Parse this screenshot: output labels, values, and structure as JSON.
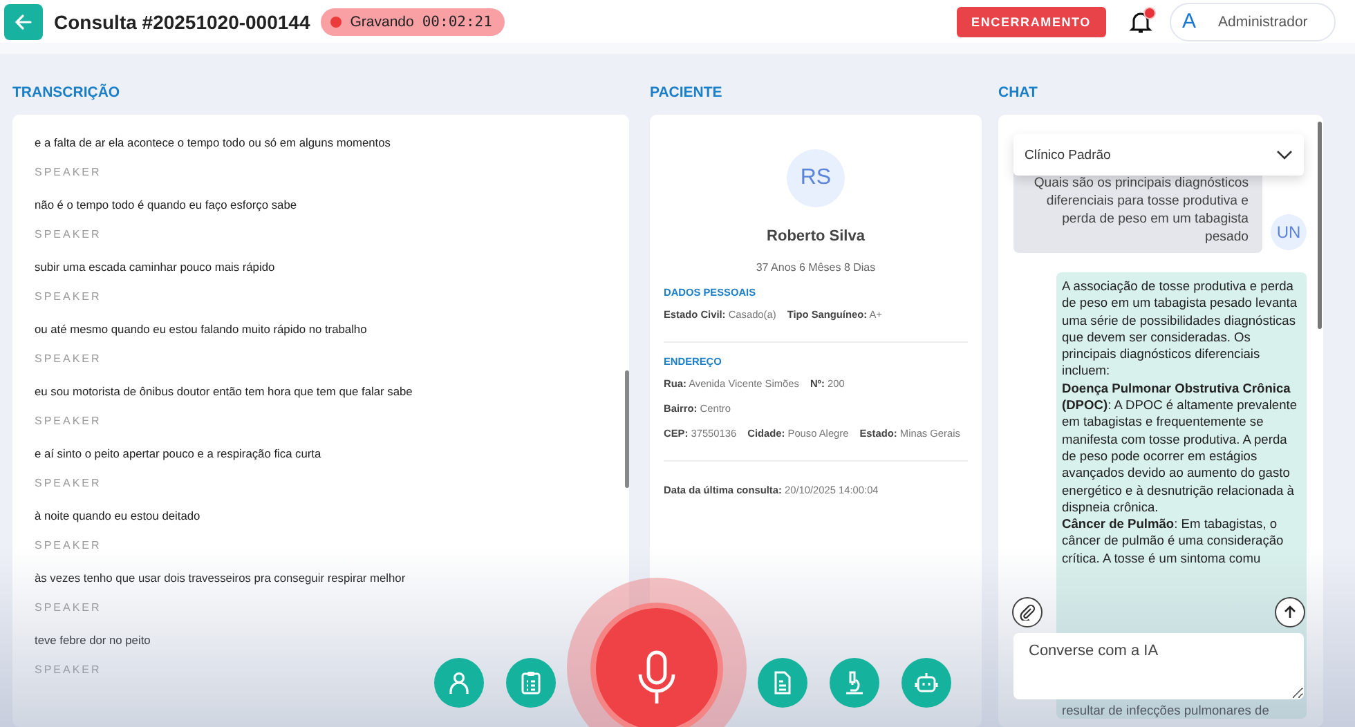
{
  "header": {
    "title": "Consulta #20251020-000144",
    "recording": {
      "label": "Gravando",
      "time": "00:02:21",
      "on": true
    },
    "end_button": "ENCERRAMENTO",
    "notifications": {
      "unread": true
    },
    "user": {
      "initial": "A",
      "name": "Administrador"
    }
  },
  "transcription": {
    "title": "TRANSCRIÇÃO",
    "lines": [
      {
        "kind": "text",
        "text": "e a falta de ar ela acontece o tempo todo ou só em alguns momentos"
      },
      {
        "kind": "speaker",
        "text": "SPEAKER"
      },
      {
        "kind": "text",
        "text": "não é o tempo todo é quando eu faço esforço sabe"
      },
      {
        "kind": "speaker",
        "text": "SPEAKER"
      },
      {
        "kind": "text",
        "text": "subir uma escada caminhar pouco mais rápido"
      },
      {
        "kind": "speaker",
        "text": "SPEAKER"
      },
      {
        "kind": "text",
        "text": "ou até mesmo quando eu estou falando muito rápido no trabalho"
      },
      {
        "kind": "speaker",
        "text": "SPEAKER"
      },
      {
        "kind": "text",
        "text": "eu sou motorista de ônibus doutor então tem hora que tem que falar sabe"
      },
      {
        "kind": "speaker",
        "text": "SPEAKER"
      },
      {
        "kind": "text",
        "text": "e aí sinto o peito apertar pouco e a respiração fica curta"
      },
      {
        "kind": "speaker",
        "text": "SPEAKER"
      },
      {
        "kind": "text",
        "text": "à noite quando eu estou deitado"
      },
      {
        "kind": "speaker",
        "text": "SPEAKER"
      },
      {
        "kind": "text",
        "text": "às vezes tenho que usar dois travesseiros pra conseguir respirar melhor"
      },
      {
        "kind": "speaker",
        "text": "SPEAKER"
      },
      {
        "kind": "text",
        "text": "teve febre dor no peito"
      },
      {
        "kind": "speaker",
        "text": "SPEAKER"
      }
    ]
  },
  "patient": {
    "title": "PACIENTE",
    "initials": "RS",
    "name": "Roberto Silva",
    "age": "37 Anos 6 Mêses 8 Dias",
    "sections": [
      {
        "title": "DADOS PESSOAIS",
        "rows": [
          [
            {
              "label": "Estado Civil:",
              "value": "Casado(a)"
            },
            {
              "label": "Tipo Sanguíneo:",
              "value": "A+"
            }
          ]
        ]
      },
      {
        "title": "ENDEREÇO",
        "rows": [
          [
            {
              "label": "Rua:",
              "value": "Avenida Vicente Simões"
            },
            {
              "label": "Nº:",
              "value": "200"
            }
          ],
          [
            {
              "label": "Bairro:",
              "value": "Centro"
            }
          ],
          [
            {
              "label": "CEP:",
              "value": "37550136"
            },
            {
              "label": "Cidade:",
              "value": "Pouso Alegre"
            },
            {
              "label": "Estado:",
              "value": "Minas Gerais"
            }
          ]
        ]
      }
    ],
    "last_visit": {
      "label": "Data da última consulta:",
      "value": "20/10/2025 14:00:04"
    }
  },
  "chat": {
    "title": "CHAT",
    "model_select": "Clínico Padrão",
    "messages": [
      {
        "kind": "user",
        "avatar": "UN",
        "text": "Quais são os principais diagnósticos diferenciais para tosse produtiva e perda de peso em um tabagista pesado"
      },
      {
        "kind": "assistant",
        "paragraphs": [
          "A associação de tosse produtiva e perda de peso em um tabagista pesado levanta uma série de possibilidades diagnósticas que devem ser consideradas. Os principais diagnósticos diferenciais incluem:",
          "**Doença Pulmonar Obstrutiva Crônica (DPOC)**: A DPOC é altamente prevalente em tabagistas e frequentemente se manifesta com tosse produtiva. A perda de peso pode ocorrer em estágios avançados devido ao aumento do gasto energético e à desnutrição relacionada à dispneia crônica.",
          "**Câncer de Pulmão**: Em tabagistas, o câncer de pulmão é uma consideração crítica. A tosse é um sintoma comu"
        ],
        "tail": "resultar de infecções pulmonares de"
      }
    ],
    "input_placeholder": "Converse com a IA"
  },
  "toolbar": [
    {
      "kind": "person"
    },
    {
      "kind": "clipboard"
    },
    {
      "kind": "mic"
    },
    {
      "kind": "document"
    },
    {
      "kind": "microscope"
    },
    {
      "kind": "robot"
    }
  ]
}
